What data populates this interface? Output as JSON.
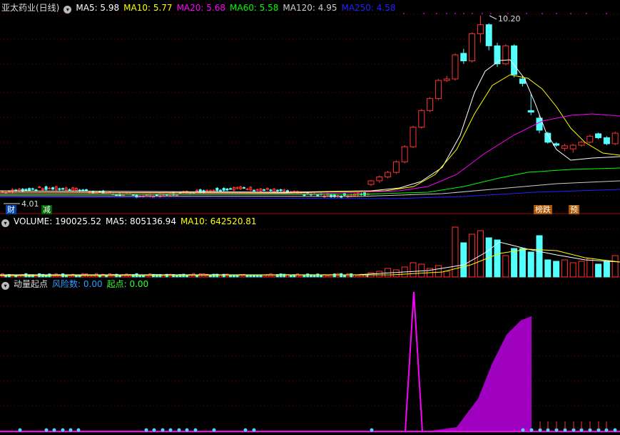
{
  "main_panel": {
    "title": "亚太药业(日线)",
    "ma_items": [
      {
        "label": "MA5: 5.98",
        "color": "#ffffff"
      },
      {
        "label": "MA10: 5.77",
        "color": "#ffff00"
      },
      {
        "label": "MA20: 5.68",
        "color": "#ff00ff"
      },
      {
        "label": "MA60: 5.58",
        "color": "#00ff00"
      },
      {
        "label": "MA120: 4.95",
        "color": "#cccccc"
      },
      {
        "label": "MA250: 4.58",
        "color": "#2222ff"
      }
    ],
    "high_label": "10.20",
    "low_label": "4.01",
    "badges": {
      "cai": "财",
      "jian": "减",
      "bangdie": "榜跌",
      "yu": "预"
    }
  },
  "volume_panel": {
    "items": [
      {
        "label": "VOLUME: 190025.52",
        "color": "#ffffff"
      },
      {
        "label": "MA5: 805136.94",
        "color": "#ffffff"
      },
      {
        "label": "MA10: 642520.81",
        "color": "#ffff00"
      }
    ]
  },
  "indicator_panel": {
    "title": "动量起点",
    "items": [
      {
        "label": "风险数: 0.00",
        "color": "#3399ff"
      },
      {
        "label": "起点: 0.00",
        "color": "#33ff33"
      }
    ]
  },
  "colors": {
    "up": "#ff3333",
    "down": "#54ffff",
    "grid": "#7a0000",
    "purple": "#a000c0",
    "magenta": "#ff00ff"
  },
  "chart_data": {
    "type": "candlestick",
    "price_range": [
      4.01,
      10.2
    ],
    "candles_tail": [
      [
        4.6,
        4.75,
        4.55,
        4.72
      ],
      [
        4.72,
        4.9,
        4.65,
        4.85
      ],
      [
        4.85,
        5.05,
        4.8,
        5.0
      ],
      [
        5.0,
        5.4,
        4.95,
        5.35
      ],
      [
        5.35,
        5.9,
        5.3,
        5.85
      ],
      [
        5.85,
        6.55,
        5.8,
        6.5
      ],
      [
        6.5,
        7.1,
        6.45,
        7.05
      ],
      [
        7.05,
        7.5,
        7.0,
        7.45
      ],
      [
        7.45,
        8.1,
        7.4,
        8.05
      ],
      [
        8.05,
        8.2,
        8.0,
        8.1
      ],
      [
        8.1,
        8.95,
        8.05,
        8.9
      ],
      [
        8.95,
        9.1,
        8.6,
        8.7
      ],
      [
        8.7,
        9.65,
        8.65,
        9.6
      ],
      [
        9.6,
        10.2,
        9.3,
        9.9
      ],
      [
        9.9,
        9.95,
        9.05,
        9.2
      ],
      [
        9.2,
        9.3,
        8.5,
        8.6
      ],
      [
        8.6,
        9.25,
        8.55,
        9.2
      ],
      [
        9.2,
        9.25,
        8.15,
        8.25
      ],
      [
        8.1,
        8.2,
        7.85,
        7.95
      ],
      [
        7.05,
        7.6,
        6.9,
        7.0
      ],
      [
        6.8,
        6.9,
        6.3,
        6.4
      ],
      [
        6.3,
        6.35,
        5.95,
        6.0
      ],
      [
        5.95,
        6.0,
        5.85,
        5.9
      ],
      [
        5.8,
        5.95,
        5.7,
        5.88
      ],
      [
        5.78,
        5.95,
        5.65,
        5.9
      ],
      [
        5.9,
        6.05,
        5.85,
        6.0
      ],
      [
        6.0,
        6.25,
        5.95,
        6.2
      ],
      [
        6.28,
        6.32,
        6.1,
        6.15
      ],
      [
        6.15,
        6.2,
        5.9,
        5.95
      ],
      [
        5.95,
        6.35,
        5.9,
        6.3
      ]
    ]
  }
}
